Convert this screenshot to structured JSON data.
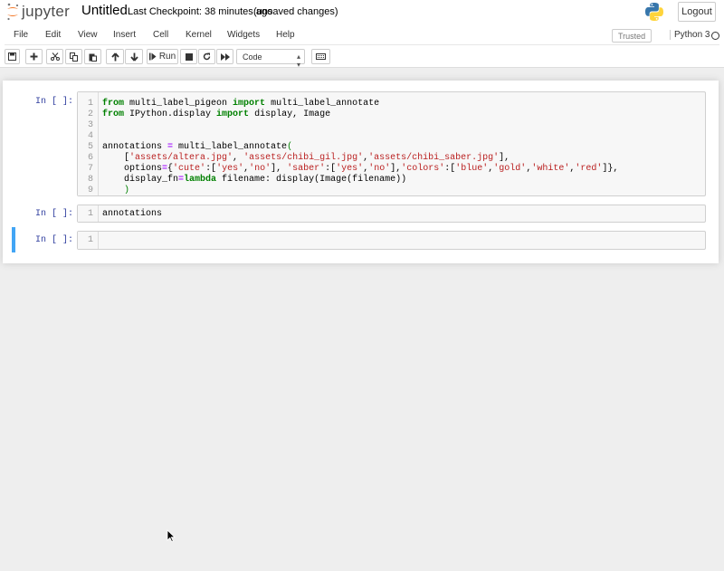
{
  "app": {
    "logo_text": "jupyter",
    "notebook_name": "Untitled",
    "checkpoint": "Last Checkpoint: 38 minutes ago",
    "autosave_status": "(unsaved changes)",
    "logout_label": "Logout"
  },
  "menu": {
    "items": [
      "File",
      "Edit",
      "View",
      "Insert",
      "Cell",
      "Kernel",
      "Widgets",
      "Help"
    ],
    "trusted_label": "Trusted",
    "kernel_name": "Python 3"
  },
  "toolbar": {
    "run_label": "Run",
    "cell_type": "Code"
  },
  "cells": [
    {
      "prompt": "In [ ]:",
      "lines": [
        {
          "n": "1",
          "text": "from multi_label_pigeon import multi_label_annotate"
        },
        {
          "n": "2",
          "text": "from IPython.display import display, Image"
        },
        {
          "n": "3",
          "text": ""
        },
        {
          "n": "4",
          "text": ""
        },
        {
          "n": "5",
          "text": "annotations = multi_label_annotate("
        },
        {
          "n": "6",
          "text": "    ['assets/altera.jpg', 'assets/chibi_gil.jpg','assets/chibi_saber.jpg'],"
        },
        {
          "n": "7",
          "text": "    options={'cute':['yes','no'], 'saber':['yes','no'],'colors':['blue','gold','white','red']},"
        },
        {
          "n": "8",
          "text": "    display_fn=lambda filename: display(Image(filename))"
        },
        {
          "n": "9",
          "text": "    )"
        }
      ]
    },
    {
      "prompt": "In [ ]:",
      "lines": [
        {
          "n": "1",
          "text": "annotations"
        }
      ]
    },
    {
      "prompt": "In [ ]:",
      "lines": [
        {
          "n": "1",
          "text": ""
        }
      ]
    }
  ],
  "colors": {
    "keyword": "#008000",
    "string": "#ba2121",
    "prompt": "#303f9f",
    "selected_cell": "#42a5f5"
  }
}
